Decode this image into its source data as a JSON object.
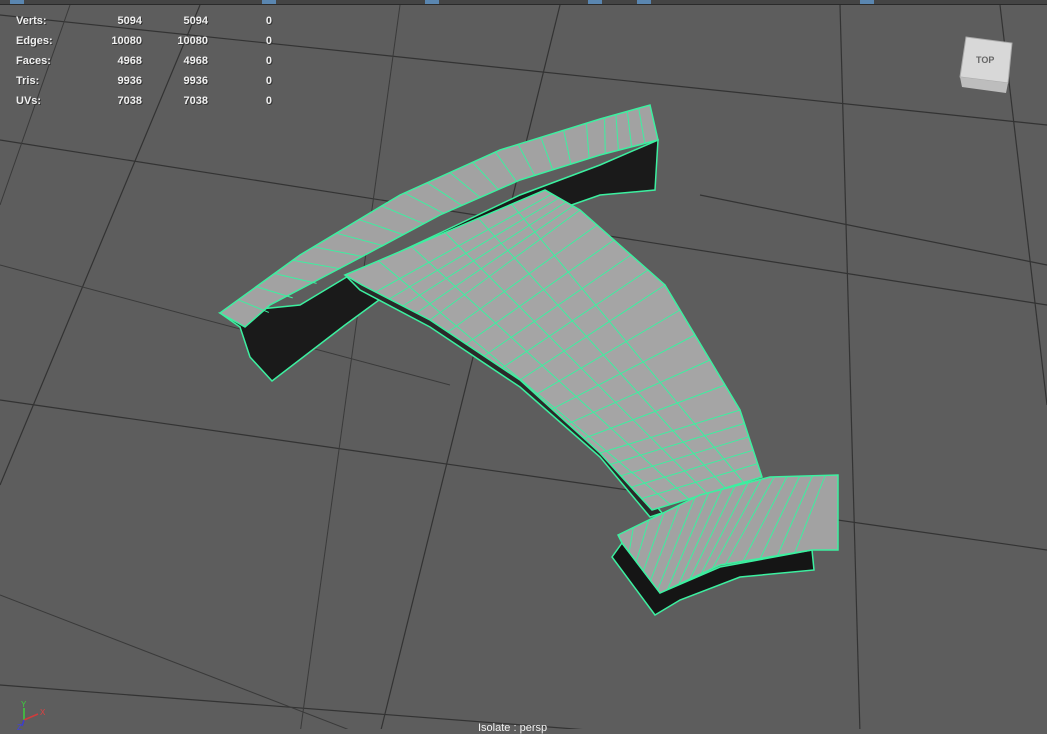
{
  "hud": {
    "rows": [
      {
        "label": "Verts:",
        "a": "5094",
        "b": "5094",
        "c": "0"
      },
      {
        "label": "Edges:",
        "a": "10080",
        "b": "10080",
        "c": "0"
      },
      {
        "label": "Faces:",
        "a": "4968",
        "b": "4968",
        "c": "0"
      },
      {
        "label": "Tris:",
        "a": "9936",
        "b": "9936",
        "c": "0"
      },
      {
        "label": "UVs:",
        "a": "7038",
        "b": "7038",
        "c": "0"
      }
    ]
  },
  "view_cube": {
    "label": "TOP"
  },
  "axis": {
    "x": "X",
    "y": "Y",
    "z": "Z"
  },
  "viewport_label": "Isolate : persp",
  "colors": {
    "background": "#5d5d5d",
    "wire": "#3cf0a0",
    "face": "#9a9a9a",
    "grid": "#333333"
  }
}
